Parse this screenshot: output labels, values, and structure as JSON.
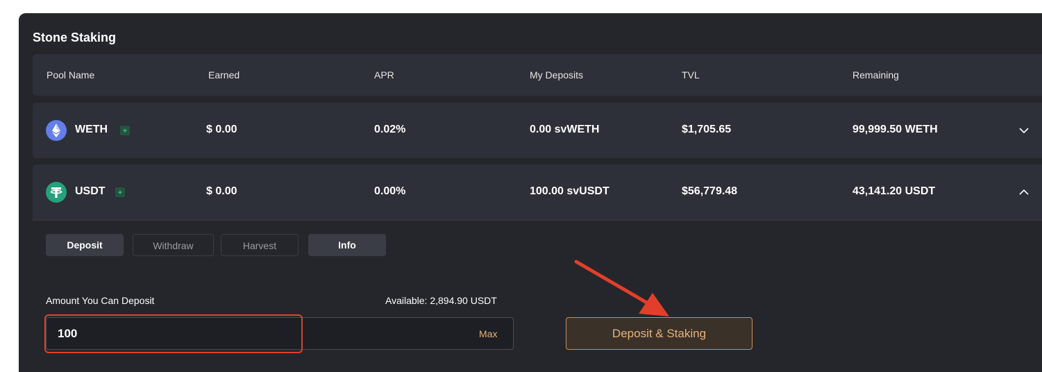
{
  "panel": {
    "title": "Stone Staking"
  },
  "header": {
    "pool_name": "Pool Name",
    "earned": "Earned",
    "apr": "APR",
    "my_deposits": "My Deposits",
    "tvl": "TVL",
    "remaining": "Remaining"
  },
  "pools": [
    {
      "name": "WETH",
      "icon": "ethereum-icon",
      "earned": "$ 0.00",
      "apr": "0.02%",
      "my_deposits": "0.00 svWETH",
      "tvl": "$1,705.65",
      "remaining": "99,999.50 WETH",
      "expanded": false
    },
    {
      "name": "USDT",
      "icon": "tether-icon",
      "earned": "$ 0.00",
      "apr": "0.00%",
      "my_deposits": "100.00 svUSDT",
      "tvl": "$56,779.48",
      "remaining": "43,141.20 USDT",
      "expanded": true
    }
  ],
  "tabs": [
    "Deposit",
    "Withdraw",
    "Harvest",
    "Info"
  ],
  "deposit_form": {
    "amount_label": "Amount You Can Deposit",
    "available": "Available: 2,894.90 USDT",
    "input_value": "100",
    "max_label": "Max",
    "submit_label": "Deposit & Staking"
  },
  "colors": {
    "panel_bg": "#24262c",
    "row_bg": "#2d3038",
    "accent": "#e6b17e",
    "annotation_red": "#e23f2a",
    "plus_green": "#4ad991"
  }
}
